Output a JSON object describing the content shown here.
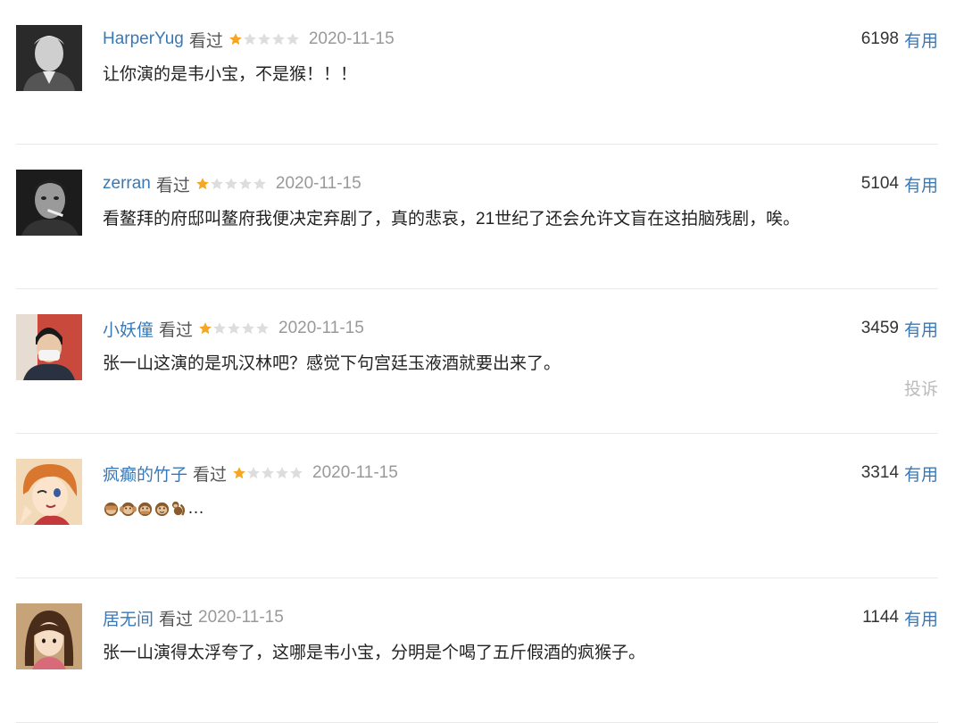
{
  "colors": {
    "link": "#3a78b5",
    "star_on": "#f5a623",
    "star_off": "#dddddd",
    "muted": "#999999",
    "divider": "#e9e9e9"
  },
  "comments": [
    {
      "username": "HarperYug",
      "status": "看过",
      "rating": 1,
      "rating_max": 5,
      "date": "2020-11-15",
      "votes": "6198",
      "useful_label": "有用",
      "text": "让你演的是韦小宝，不是猴！！！",
      "avatar_icon": "bw-portrait-avatar"
    },
    {
      "username": "zerran",
      "status": "看过",
      "rating": 1,
      "rating_max": 5,
      "date": "2020-11-15",
      "votes": "5104",
      "useful_label": "有用",
      "text": "看鳌拜的府邸叫鳌府我便决定弃剧了，真的悲哀，21世纪了还会允许文盲在这拍脑残剧，唉。",
      "avatar_icon": "smoking-man-avatar"
    },
    {
      "username": "小妖僮",
      "status": "看过",
      "rating": 1,
      "rating_max": 5,
      "date": "2020-11-15",
      "votes": "3459",
      "useful_label": "有用",
      "text": "张一山这演的是巩汉林吧？感觉下句宫廷玉液酒就要出来了。",
      "report_label": "投诉",
      "avatar_icon": "masked-boy-avatar"
    },
    {
      "username": "疯癫的竹子",
      "status": "看过",
      "rating": 1,
      "rating_max": 5,
      "date": "2020-11-15",
      "votes": "3314",
      "useful_label": "有用",
      "text_emojis": [
        "see-no-evil-monkey-icon",
        "hear-no-evil-monkey-icon",
        "speak-no-evil-monkey-icon",
        "monkey-face-icon",
        "monkey-icon"
      ],
      "text": "…",
      "avatar_icon": "anime-girl-avatar"
    },
    {
      "username": "居无间",
      "status": "看过",
      "date": "2020-11-15",
      "votes": "1144",
      "useful_label": "有用",
      "text": "张一山演得太浮夸了，这哪是韦小宝，分明是个喝了五斤假酒的疯猴子。",
      "avatar_icon": "chihiro-avatar"
    }
  ]
}
